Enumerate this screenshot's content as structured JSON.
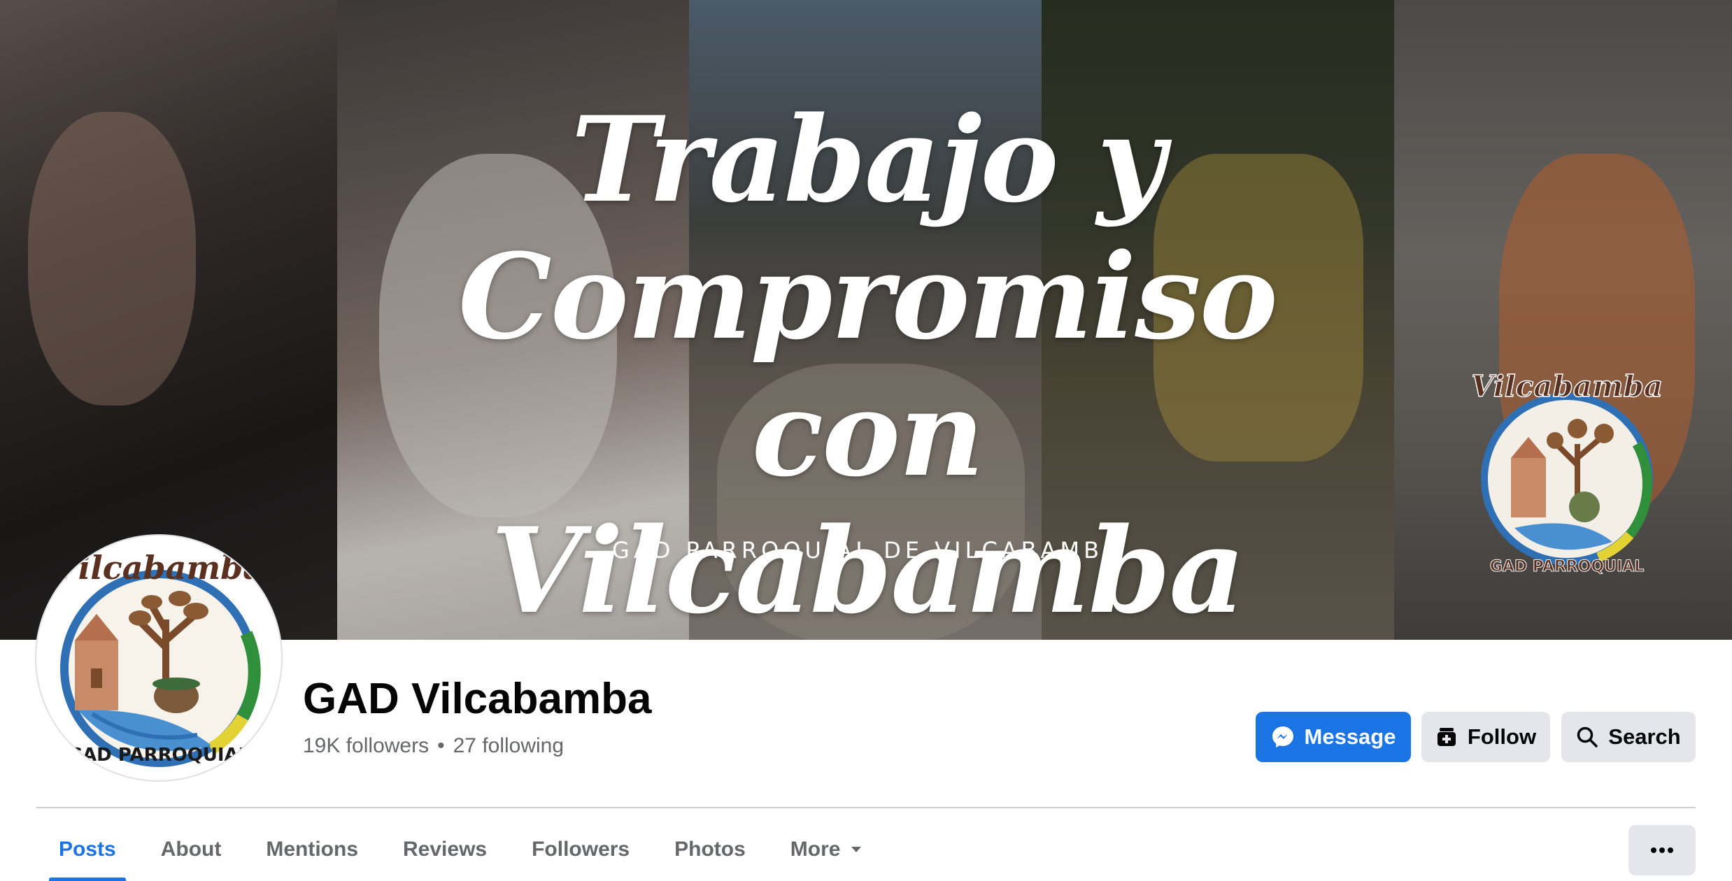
{
  "cover": {
    "title_lines": [
      "Trabajo y",
      "Compromiso con",
      "Vilcabamba"
    ],
    "subtitle": "GAD PARROQUIAL DE VILCABAMBA",
    "seal_top_text": "Vilcabamba",
    "seal_bottom_text": "GAD PARROQUIAL"
  },
  "profile": {
    "avatar_top_text": "Vilcabamba",
    "avatar_bottom_text": "GAD PARROQUIAL",
    "name": "GAD Vilcabamba",
    "followers": "19K followers",
    "separator": "•",
    "following": "27 following"
  },
  "actions": {
    "message": {
      "label": "Message",
      "icon": "messenger-icon"
    },
    "follow": {
      "label": "Follow",
      "icon": "follow-icon"
    },
    "search": {
      "label": "Search",
      "icon": "search-icon"
    }
  },
  "tabs": [
    {
      "label": "Posts",
      "active": true
    },
    {
      "label": "About"
    },
    {
      "label": "Mentions"
    },
    {
      "label": "Reviews"
    },
    {
      "label": "Followers"
    },
    {
      "label": "Photos"
    },
    {
      "label": "More"
    }
  ],
  "overflow_menu": {
    "icon": "more-horizontal-icon"
  },
  "colors": {
    "accent": "#1b74e4",
    "secondary_text": "#65676b",
    "button_gray": "#e4e6eb"
  }
}
